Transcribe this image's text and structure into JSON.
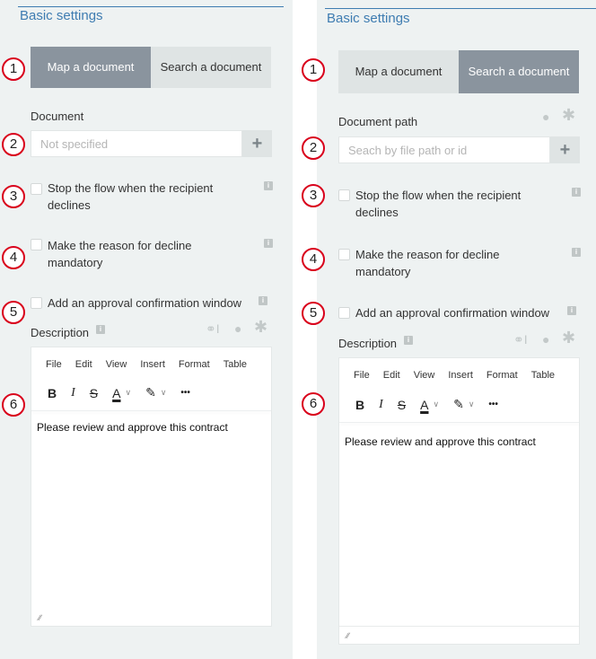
{
  "title": "Basic settings",
  "markers": [
    "1",
    "2",
    "3",
    "4",
    "5",
    "6"
  ],
  "left": {
    "segments": {
      "map": "Map a document",
      "search": "Search a document",
      "active": "map"
    },
    "document_label": "Document",
    "document_input_placeholder": "Not specified",
    "add_symbol": "+",
    "checkbox_stop": "Stop the flow when the recipient declines",
    "checkbox_reason": "Make the reason for decline mandatory",
    "checkbox_confirm": "Add an approval confirmation window",
    "description_label": "Description",
    "editor_menu": [
      "File",
      "Edit",
      "View",
      "Insert",
      "Format",
      "Table"
    ],
    "editor_content": "Please review and approve this contract"
  },
  "right": {
    "segments": {
      "map": "Map a document",
      "search": "Search a document",
      "active": "search"
    },
    "document_label": "Document path",
    "document_input_placeholder": "Seach by file path or id",
    "add_symbol": "+",
    "checkbox_stop": "Stop the flow when the recipient declines",
    "checkbox_reason": "Make the reason for decline mandatory",
    "checkbox_confirm": "Add an approval confirmation window",
    "description_label": "Description",
    "editor_menu": [
      "File",
      "Edit",
      "View",
      "Insert",
      "Format",
      "Table"
    ],
    "editor_content": "Please review and approve this contract"
  },
  "toolbar": {
    "bold": "B",
    "italic": "I",
    "strike": "S",
    "text_color": "A",
    "more": "•••"
  },
  "icons": {
    "info": "info-icon",
    "user": "user-icon",
    "required": "asterisk-icon",
    "link": "link-icon",
    "plus": "plus-icon",
    "chevron": "chevron-down-icon",
    "highlighter": "highlighter-icon",
    "resize": "resize-handle-icon"
  },
  "colors": {
    "accent": "#3e7cb1",
    "marker": "#d9001b",
    "active_segment": "#8a949e",
    "panel_bg": "#eef2f2"
  }
}
